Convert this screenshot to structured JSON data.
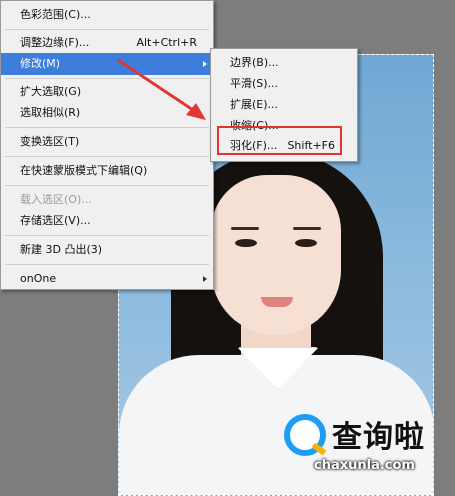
{
  "main_menu": {
    "items": [
      {
        "label": "色彩范围(C)...",
        "shortcut": "",
        "state": "normal"
      },
      {
        "label": "调整边缘(F)...",
        "shortcut": "Alt+Ctrl+R",
        "state": "normal"
      },
      {
        "label": "修改(M)",
        "shortcut": "",
        "state": "highlighted",
        "submenu": true
      },
      {
        "label": "扩大选取(G)",
        "shortcut": "",
        "state": "normal"
      },
      {
        "label": "选取相似(R)",
        "shortcut": "",
        "state": "normal"
      },
      {
        "label": "变换选区(T)",
        "shortcut": "",
        "state": "normal"
      },
      {
        "label": "在快速蒙版模式下编辑(Q)",
        "shortcut": "",
        "state": "normal"
      },
      {
        "label": "载入选区(O)...",
        "shortcut": "",
        "state": "disabled"
      },
      {
        "label": "存储选区(V)...",
        "shortcut": "",
        "state": "normal"
      },
      {
        "label": "新建 3D 凸出(3)",
        "shortcut": "",
        "state": "normal"
      },
      {
        "label": "onOne",
        "shortcut": "",
        "state": "normal",
        "submenu": true
      }
    ]
  },
  "submenu": {
    "items": [
      {
        "label": "边界(B)...",
        "shortcut": ""
      },
      {
        "label": "平滑(S)...",
        "shortcut": ""
      },
      {
        "label": "扩展(E)...",
        "shortcut": ""
      },
      {
        "label": "收缩(C)...",
        "shortcut": ""
      },
      {
        "label": "羽化(F)...",
        "shortcut": "Shift+F6"
      }
    ]
  },
  "watermark": {
    "title": "查询啦",
    "url": "chaxunla.com"
  },
  "colors": {
    "menu_bg": "#f0f0f0",
    "highlight": "#3d7edc",
    "annotation_red": "#e43333",
    "watermark_blue": "#1d9df4"
  }
}
